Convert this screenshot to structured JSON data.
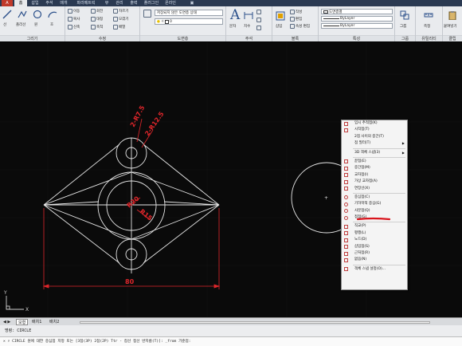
{
  "tabs": [
    "홈",
    "삽입",
    "주석",
    "매개",
    "파라메트릭",
    "뷰",
    "관리",
    "출력",
    "플러그인",
    "온라인"
  ],
  "ribbon": {
    "panels": {
      "draw": "그리기",
      "modify": "수정",
      "layers": "도면층",
      "annotation": "주석",
      "block": "블록",
      "properties": "특성",
      "groups": "그룹",
      "utilities": "유틸리티",
      "clipboard": "클립"
    },
    "draw_tools": [
      "선",
      "폴리선",
      "원",
      "호"
    ],
    "modify_tools": {
      "move": "이동",
      "rotate": "회전",
      "trim": "자르기",
      "copy": "복사",
      "mirror": "대칭",
      "fillet": "모깎기",
      "stretch": "신축",
      "scale": "축척",
      "array": "배열"
    },
    "layer_state": "저장되지 않은 도면층 상태",
    "text_label": "문자",
    "dimension_label": "치수",
    "insert_label": "삽입",
    "block_tools": [
      "작성",
      "편집",
      "속성 편집"
    ],
    "bylayer_color": "도면층별",
    "bylayer_1": "ByLayer",
    "bylayer_2": "ByLayer",
    "group_label": "그룹",
    "measure_label": "측정",
    "paste_label": "붙여넣기"
  },
  "drawing": {
    "dims": {
      "r75a": "2-R7.5",
      "r125": "2-R12.5",
      "r20": "R20",
      "r15": "R15",
      "width": "80"
    },
    "ucs": {
      "x": "X",
      "y": "Y"
    }
  },
  "context_menu": [
    {
      "label": "임시 추적점(K)",
      "icon": "temp-track-icon"
    },
    {
      "label": "시작점(T)",
      "icon": "from-icon"
    },
    {
      "label": "2점 사이의 중간(T)",
      "icon": "none"
    },
    {
      "label": "점 필터(T)",
      "icon": "none",
      "submenu": true
    },
    {
      "sep": true
    },
    {
      "label": "3D 객체 스냅(3)",
      "icon": "none",
      "submenu": true
    },
    {
      "sep": true
    },
    {
      "label": "끝점(E)",
      "icon": "endpoint-icon"
    },
    {
      "label": "중간점(M)",
      "icon": "midpoint-icon"
    },
    {
      "label": "교차점(I)",
      "icon": "intersection-icon"
    },
    {
      "label": "가상 교차점(A)",
      "icon": "apparent-int-icon"
    },
    {
      "label": "연장선(X)",
      "icon": "extension-icon"
    },
    {
      "sep": true
    },
    {
      "label": "중심점(C)",
      "icon": "center-icon"
    },
    {
      "label": "기하학적 중심(G)",
      "icon": "geometric-center-icon"
    },
    {
      "label": "사분점(Q)",
      "icon": "quadrant-icon"
    },
    {
      "label": "접점(G)",
      "icon": "tangent-icon"
    },
    {
      "sep": true
    },
    {
      "label": "직교(P)",
      "icon": "perpendicular-icon"
    },
    {
      "label": "평행(L)",
      "icon": "parallel-icon"
    },
    {
      "label": "노드(D)",
      "icon": "node-icon"
    },
    {
      "label": "삽입점(S)",
      "icon": "insertion-icon"
    },
    {
      "label": "근처점(R)",
      "icon": "nearest-icon"
    },
    {
      "label": "없음(N)",
      "icon": "none-icon"
    },
    {
      "sep": true
    },
    {
      "label": "객체 스냅 설정(O)...",
      "icon": "osnap-settings-icon"
    }
  ],
  "layout_tabs": [
    "모형",
    "배치1",
    "배치2"
  ],
  "command": {
    "history": "명령: CIRCLE",
    "prompt": "CIRCLE 원에 대한 중심점 지정 또는 [3점(3P) 2점(2P) Ttr - 접선 접선 반지름(T)]:  _from 기준점:"
  },
  "colors": {
    "dim": "#e0262b",
    "geom": "#e6e6e6",
    "underline": "#d9141c",
    "ribbon_bg": "#e9ebee",
    "top_bar": "#2b3a52"
  }
}
